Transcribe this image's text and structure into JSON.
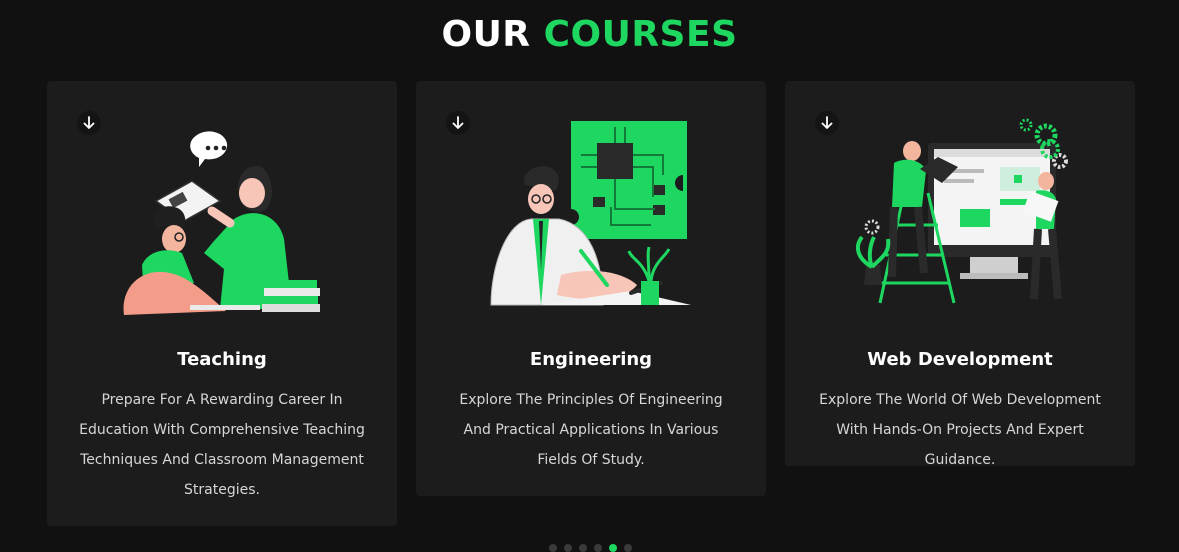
{
  "heading": {
    "word1": "OUR",
    "word2": "COURSES"
  },
  "colors": {
    "accent": "#1ed760",
    "background": "#111111",
    "card": "#1c1c1c"
  },
  "cards": [
    {
      "icon": "arrow-down-icon",
      "illustration": "teacher-student-reading-illustration",
      "title": "Teaching",
      "description": "Prepare For A Rewarding Career In Education With Comprehensive Teaching Techniques And Classroom Management Strategies."
    },
    {
      "icon": "arrow-down-icon",
      "illustration": "engineer-circuit-board-illustration",
      "title": "Engineering",
      "description": "Explore The Principles Of Engineering And Practical Applications In Various Fields Of Study."
    },
    {
      "icon": "arrow-down-icon",
      "illustration": "web-developer-monitor-illustration",
      "title": "Web Development",
      "description": "Explore The World Of Web Development With Hands-On Projects And Expert Guidance."
    }
  ],
  "carousel": {
    "dot_count": 6,
    "active_index": 4
  }
}
